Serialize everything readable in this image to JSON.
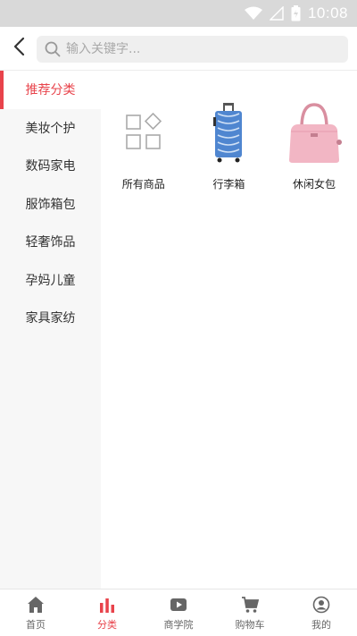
{
  "status_bar": {
    "time": "10:08",
    "icons": [
      "wifi-icon",
      "signal-icon",
      "battery-icon"
    ]
  },
  "header": {
    "back_icon": "chevron-left-icon",
    "search": {
      "placeholder": "输入关键字...",
      "value": "",
      "icon": "search-icon"
    }
  },
  "sidebar": {
    "items": [
      {
        "label": "推荐分类",
        "active": true
      },
      {
        "label": "美妆个护"
      },
      {
        "label": "数码家电"
      },
      {
        "label": "服饰箱包"
      },
      {
        "label": "轻奢饰品"
      },
      {
        "label": "孕妈儿童"
      },
      {
        "label": "家具家纺"
      }
    ]
  },
  "content": {
    "items": [
      {
        "label": "所有商品",
        "icon": "all-products-icon"
      },
      {
        "label": "行李箱",
        "icon": "suitcase-image"
      },
      {
        "label": "休闲女包",
        "icon": "handbag-image"
      }
    ]
  },
  "tabbar": {
    "tabs": [
      {
        "label": "首页",
        "icon": "home-icon"
      },
      {
        "label": "分类",
        "icon": "category-icon",
        "active": true
      },
      {
        "label": "商学院",
        "icon": "play-icon"
      },
      {
        "label": "购物车",
        "icon": "cart-icon"
      },
      {
        "label": "我的",
        "icon": "profile-icon"
      }
    ]
  },
  "colors": {
    "accent": "#e8434b",
    "status_bar_bg": "#d9d9d9",
    "sidebar_bg": "#f7f7f7",
    "search_bg": "#efefef",
    "tab_inactive": "#666666"
  }
}
